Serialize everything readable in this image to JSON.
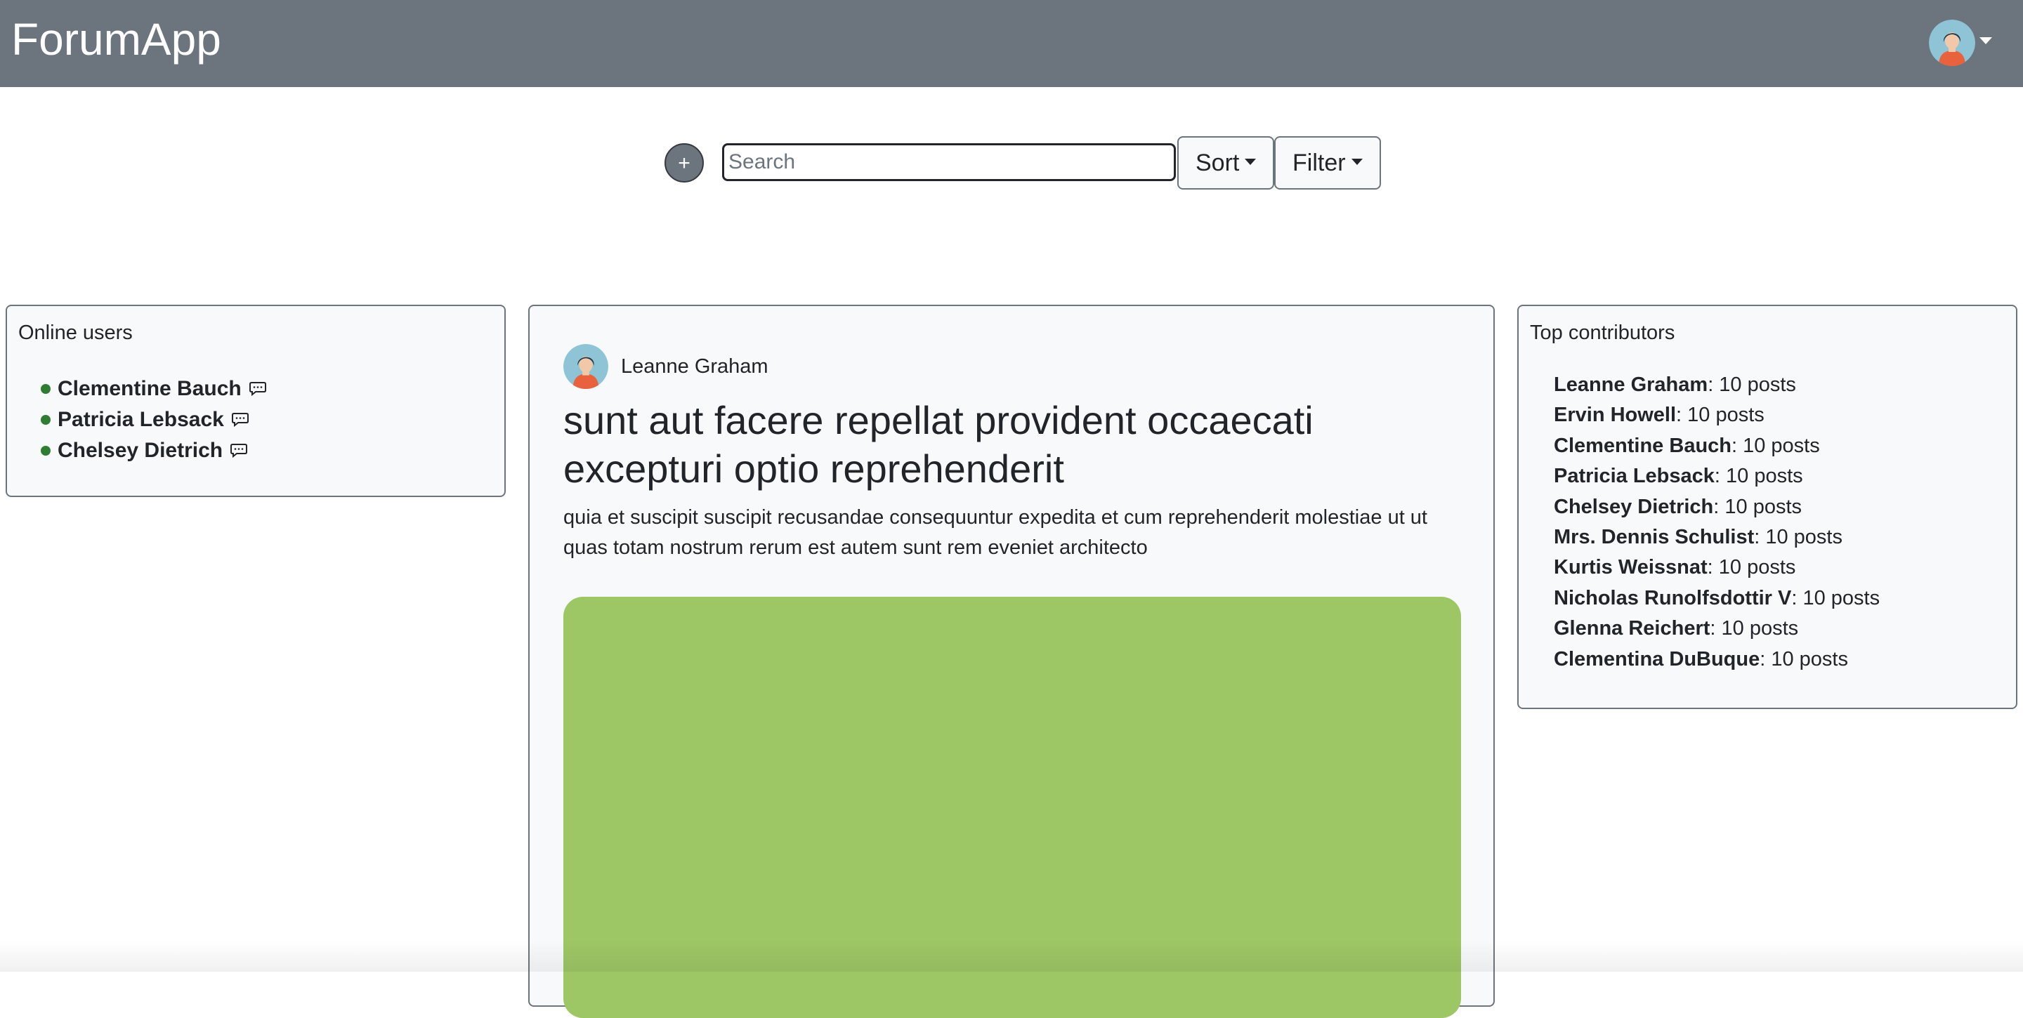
{
  "navbar": {
    "brand": "ForumApp",
    "avatar_icon": "user-avatar-icon"
  },
  "toolbar": {
    "add_label": "+",
    "search_placeholder": "Search",
    "search_value": "",
    "sort_label": "Sort",
    "filter_label": "Filter"
  },
  "online": {
    "title": "Online users",
    "status_color": "#2e7d32",
    "users": [
      {
        "name": "Clementine Bauch"
      },
      {
        "name": "Patricia Lebsack"
      },
      {
        "name": "Chelsey Dietrich"
      }
    ]
  },
  "post": {
    "author": "Leanne Graham",
    "title": "sunt aut facere repellat provident occaecati excepturi optio reprehenderit",
    "body": "quia et suscipit suscipit recusandae consequuntur expedita et cum reprehenderit molestiae ut ut quas totam nostrum rerum est autem sunt rem eveniet architecto",
    "image_color": "#9dc665"
  },
  "contributors": {
    "title": "Top contributors",
    "items": [
      {
        "name": "Leanne Graham",
        "count": ": 10 posts"
      },
      {
        "name": "Ervin Howell",
        "count": ": 10 posts"
      },
      {
        "name": "Clementine Bauch",
        "count": ": 10 posts"
      },
      {
        "name": "Patricia Lebsack",
        "count": ": 10 posts"
      },
      {
        "name": "Chelsey Dietrich",
        "count": ": 10 posts"
      },
      {
        "name": "Mrs. Dennis Schulist",
        "count": ": 10 posts"
      },
      {
        "name": "Kurtis Weissnat",
        "count": ": 10 posts"
      },
      {
        "name": "Nicholas Runolfsdottir V",
        "count": ": 10 posts"
      },
      {
        "name": "Glenna Reichert",
        "count": ": 10 posts"
      },
      {
        "name": "Clementina DuBuque",
        "count": ": 10 posts"
      }
    ]
  },
  "colors": {
    "navbar": "#6c757d",
    "panel_bg": "#f8f9fa"
  }
}
